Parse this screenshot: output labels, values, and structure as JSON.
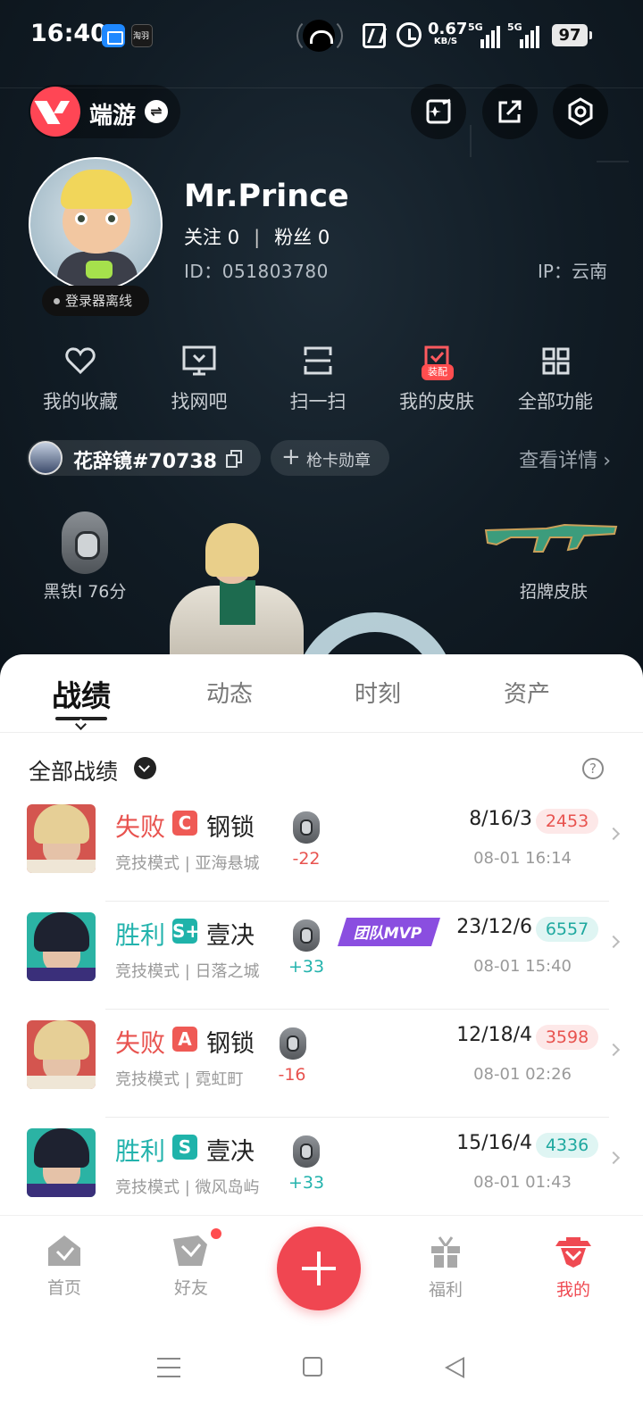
{
  "status_bar": {
    "time": "16:40",
    "net_speed_value": "0.67",
    "net_speed_unit": "KB/S",
    "signal1_gen": "5G",
    "signal2_gen": "5G",
    "battery": "97",
    "app2_label": "淘羽"
  },
  "header": {
    "game_name": "端游",
    "actions": [
      "add-post-icon",
      "share-icon",
      "settings-icon"
    ]
  },
  "profile": {
    "username": "Mr.Prince",
    "following_label": "关注",
    "following_count": "0",
    "divider": "|",
    "followers_label": "粉丝",
    "followers_count": "0",
    "id_text": "ID：051803780",
    "ip_text": "IP：云南",
    "status": "登录器离线"
  },
  "quick_actions": [
    {
      "label": "我的收藏",
      "icon": "heart-icon"
    },
    {
      "label": "找网吧",
      "icon": "monitor-icon"
    },
    {
      "label": "扫一扫",
      "icon": "scan-icon"
    },
    {
      "label": "我的皮肤",
      "icon": "skin-icon",
      "tag": "装配"
    },
    {
      "label": "全部功能",
      "icon": "grid-icon"
    }
  ],
  "game_account": {
    "name": "花辞镜#70738",
    "badge_button": "枪卡勋章",
    "details_link": "查看详情"
  },
  "showcase": {
    "rank_label": "黑铁I 76分",
    "skin_label": "招牌皮肤"
  },
  "tabs": [
    "战绩",
    "动态",
    "时刻",
    "资产"
  ],
  "filter": {
    "label": "全部战绩"
  },
  "matches": [
    {
      "result": "失败",
      "outcome": "loss",
      "grade": "C",
      "agent": "钢锁",
      "mode": "竞技模式 | 亚海悬城",
      "delta": "-22",
      "kda": "8/16/3",
      "score": "2453",
      "time": "08-01 16:14",
      "mvp": ""
    },
    {
      "result": "胜利",
      "outcome": "win",
      "grade": "S+",
      "agent": "壹决",
      "mode": "竞技模式 | 日落之城",
      "delta": "+33",
      "kda": "23/12/6",
      "score": "6557",
      "time": "08-01 15:40",
      "mvp": "团队MVP"
    },
    {
      "result": "失败",
      "outcome": "loss",
      "grade": "A",
      "agent": "钢锁",
      "mode": "竞技模式 | 霓虹町",
      "delta": "-16",
      "kda": "12/18/4",
      "score": "3598",
      "time": "08-01 02:26",
      "mvp": ""
    },
    {
      "result": "胜利",
      "outcome": "win",
      "grade": "S",
      "agent": "壹决",
      "mode": "竞技模式 | 微风岛屿",
      "delta": "+33",
      "kda": "15/16/4",
      "score": "4336",
      "time": "08-01 01:43",
      "mvp": ""
    }
  ],
  "bottom_nav": [
    {
      "label": "首页",
      "icon": "home-icon"
    },
    {
      "label": "好友",
      "icon": "friends-icon"
    },
    {
      "label": "",
      "icon": "plus-icon"
    },
    {
      "label": "福利",
      "icon": "gift-icon"
    },
    {
      "label": "我的",
      "icon": "profile-icon"
    }
  ],
  "colors": {
    "accent": "#ef4a52",
    "loss": "#e8534f",
    "win": "#23b3ad",
    "hero_bg": "#111c25"
  }
}
